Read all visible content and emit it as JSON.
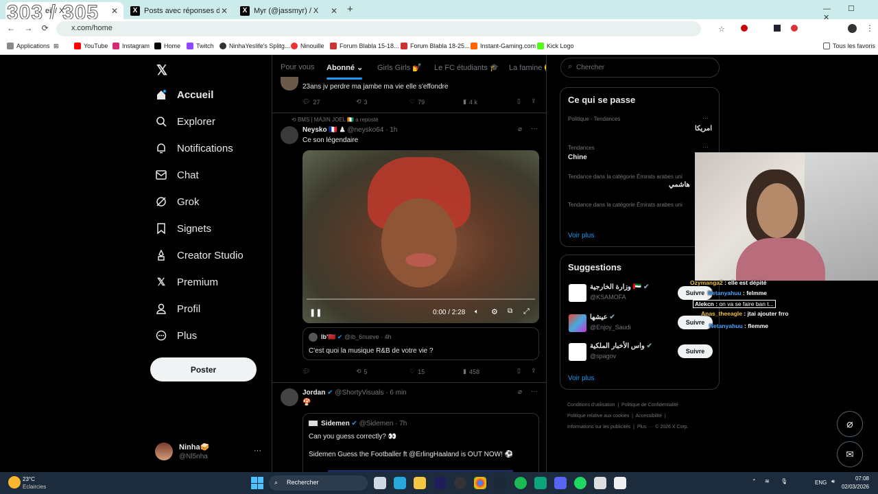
{
  "overlay": {
    "counter": "303 / 305"
  },
  "browser": {
    "tabs": [
      {
        "label": "Accueil / X",
        "partial": "eil / X"
      },
      {
        "label": "Posts avec réponses de IsmaD..."
      },
      {
        "label": "Myr (@jassmyr) / X"
      }
    ],
    "new_tab": "+",
    "url": "x.com/home",
    "bookmarks": [
      "Applications",
      "YouTube",
      "Instagram",
      "Home",
      "Twitch",
      "NinhaYeslife's Splitg...",
      "Ninouille",
      "Forum Blabla 15-18...",
      "Forum Blabla 18-25...",
      "Instant-Gaming.com",
      "Kick Logo"
    ],
    "all_bookmarks": "Tous les favoris"
  },
  "nav": {
    "items": [
      "Accueil",
      "Explorer",
      "Notifications",
      "Chat",
      "Grok",
      "Signets",
      "Creator Studio",
      "Premium",
      "Profil",
      "Plus"
    ],
    "post_button": "Poster",
    "user": {
      "name": "Ninha🥪",
      "handle": "@Nl5nha"
    }
  },
  "feed": {
    "tabs": [
      "Pour vous",
      "Abonné",
      "Girls Girls 💅",
      "Le FC étudiants 🎓",
      "La famine 😭"
    ],
    "post0": {
      "text": "23ans jv perdre ma jambe ma vie elle s'effondre",
      "replies": "27",
      "reposts": "3",
      "likes": "79",
      "views": "4 k"
    },
    "post1": {
      "repost_by": "BMS | MAJIN JOEL 🇨🇮 a reposté",
      "name": "Neysko 🇫🇷 ♟",
      "handle": "@neysko64 · 1h",
      "text": "Ce son légendaire",
      "video_time": "0:00 / 2:28",
      "quote": {
        "name": "Ib'🇲🇦",
        "handle": "@ib_6nueve · 4h",
        "text": "C'est quoi la musique R&B de votre vie ?"
      },
      "reposts": "5",
      "likes": "15",
      "views": "458"
    },
    "post2": {
      "name": "Jordan",
      "handle": "@ShortyVisuals · 6 min",
      "emoji": "🍄",
      "quote": {
        "name": "Sidemen",
        "handle": "@Sidemen · 7h",
        "line1": "Can you guess correctly? 👀",
        "line2": "Sidemen Guess the Footballer ft @ErlingHaaland is OUT NOW! ⚽"
      }
    }
  },
  "right": {
    "search_placeholder": "Chercher",
    "trends_title": "Ce qui se passe",
    "trends": [
      {
        "context": "Politique · Tendances",
        "name": "امريكا"
      },
      {
        "context": "Tendances",
        "name": "Chine"
      },
      {
        "context": "Tendance dans la catégorie Émirats arabes uni",
        "name": "هاشمي"
      },
      {
        "context": "Tendance dans la catégorie Émirats arabes uni",
        "name": ""
      }
    ],
    "show_more": "Voir plus",
    "suggestions_title": "Suggestions",
    "suggestions": [
      {
        "name": "وزارة الخارجية 🇦🇪",
        "handle": "@KSAMOFA"
      },
      {
        "name": "عيشها",
        "handle": "@Enjoy_Saudi"
      },
      {
        "name": "واس الأخبار الملكية",
        "handle": "@spagov"
      }
    ],
    "follow": "Suivre",
    "footer": [
      "Conditions d'utilisation",
      "Politique de Confidentialité",
      "Politique relative aux cookies",
      "Accessibilité",
      "Informations sur les publicités",
      "Plus ···",
      "© 2026 X Corp."
    ]
  },
  "stream_chat": [
    {
      "user": "Ozymanga2",
      "msg": "elle est dépité"
    },
    {
      "user": "Netanyahuu",
      "msg": "felmme"
    },
    {
      "user": "Alekcn",
      "msg": "on va se faire ban t..."
    },
    {
      "user": "Anas_theeagle",
      "msg": "jtai ajouter frro"
    },
    {
      "user": "Netanyahuu",
      "msg": "flemme"
    }
  ],
  "taskbar": {
    "temp": "23°C",
    "weather": "Eclaircies",
    "search": "Rechercher",
    "lang": "ENG",
    "time": "07:08",
    "date": "02/03/2026"
  }
}
